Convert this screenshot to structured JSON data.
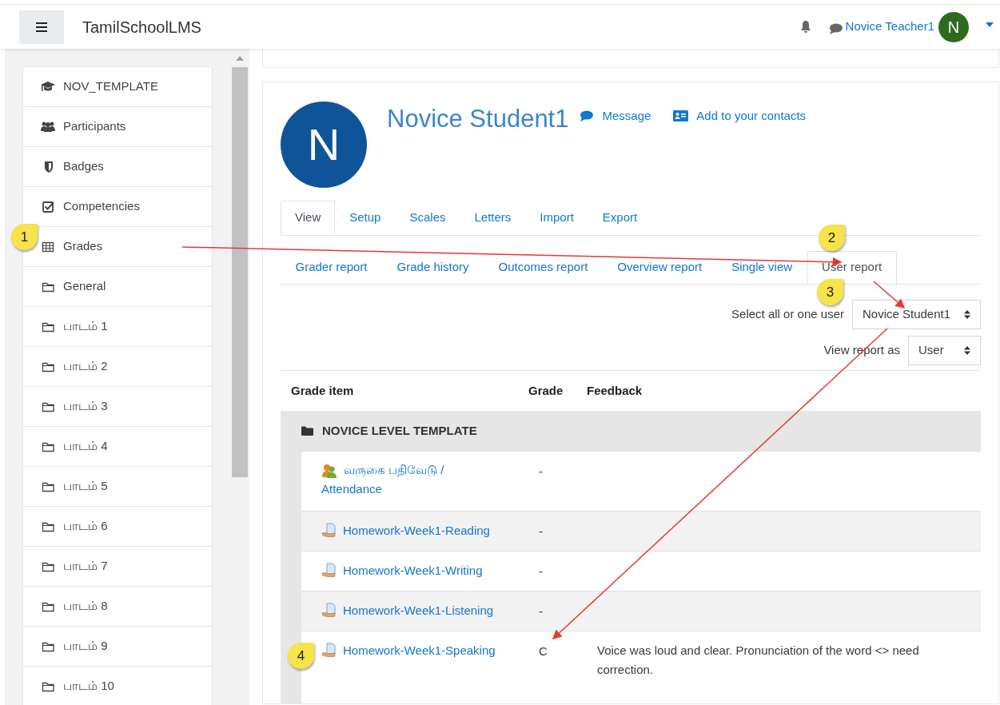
{
  "navbar": {
    "brand": "TamilSchoolLMS",
    "user_name": "Novice Teacher1",
    "user_initial": "N"
  },
  "sidebar": {
    "items": [
      {
        "label": "NOV_TEMPLATE",
        "kind": "course"
      },
      {
        "label": "Participants",
        "kind": "participants"
      },
      {
        "label": "Badges",
        "kind": "badges"
      },
      {
        "label": "Competencies",
        "kind": "competencies"
      },
      {
        "label": "Grades",
        "kind": "grades"
      },
      {
        "label": "General",
        "kind": "folder"
      },
      {
        "label": "பாடம் 1",
        "kind": "folder"
      },
      {
        "label": "பாடம் 2",
        "kind": "folder"
      },
      {
        "label": "பாடம் 3",
        "kind": "folder"
      },
      {
        "label": "பாடம் 4",
        "kind": "folder"
      },
      {
        "label": "பாடம் 5",
        "kind": "folder"
      },
      {
        "label": "பாடம் 6",
        "kind": "folder"
      },
      {
        "label": "பாடம் 7",
        "kind": "folder"
      },
      {
        "label": "பாடம் 8",
        "kind": "folder"
      },
      {
        "label": "பாடம் 9",
        "kind": "folder"
      },
      {
        "label": "பாடம் 10",
        "kind": "folder"
      }
    ]
  },
  "profile": {
    "initial": "N",
    "name": "Novice Student1",
    "message_link": "Message",
    "contacts_link": "Add to your contacts"
  },
  "tabs": [
    {
      "label": "View",
      "selected": true
    },
    {
      "label": "Setup",
      "selected": false
    },
    {
      "label": "Scales",
      "selected": false
    },
    {
      "label": "Letters",
      "selected": false
    },
    {
      "label": "Import",
      "selected": false
    },
    {
      "label": "Export",
      "selected": false
    }
  ],
  "subtabs": [
    {
      "label": "Grader report",
      "selected": false
    },
    {
      "label": "Grade history",
      "selected": false
    },
    {
      "label": "Outcomes report",
      "selected": false
    },
    {
      "label": "Overview report",
      "selected": false
    },
    {
      "label": "Single view",
      "selected": false
    },
    {
      "label": "User report",
      "selected": true
    }
  ],
  "filters": [
    {
      "label": "Select all or one user",
      "value": "Novice Student1"
    },
    {
      "label": "View report as",
      "value": "User"
    }
  ],
  "table": {
    "columns": [
      "Grade item",
      "Grade",
      "Feedback"
    ],
    "category": "NOVICE LEVEL TEMPLATE",
    "rows": [
      {
        "item": "வருகை பதிவேடு / Attendance",
        "kind": "attendance",
        "grade": "-"
      },
      {
        "item": "Homework-Week1-Reading",
        "kind": "assignment",
        "grade": "-"
      },
      {
        "item": "Homework-Week1-Writing",
        "kind": "assignment",
        "grade": "-"
      },
      {
        "item": "Homework-Week1-Listening",
        "kind": "assignment",
        "grade": "-"
      },
      {
        "item": "Homework-Week1-Speaking",
        "kind": "assignment",
        "grade": "C",
        "feedback": "Voice was loud and clear. Pronunciation of the word <> need correction."
      }
    ]
  },
  "callouts": [
    "1",
    "2",
    "3",
    "4"
  ]
}
